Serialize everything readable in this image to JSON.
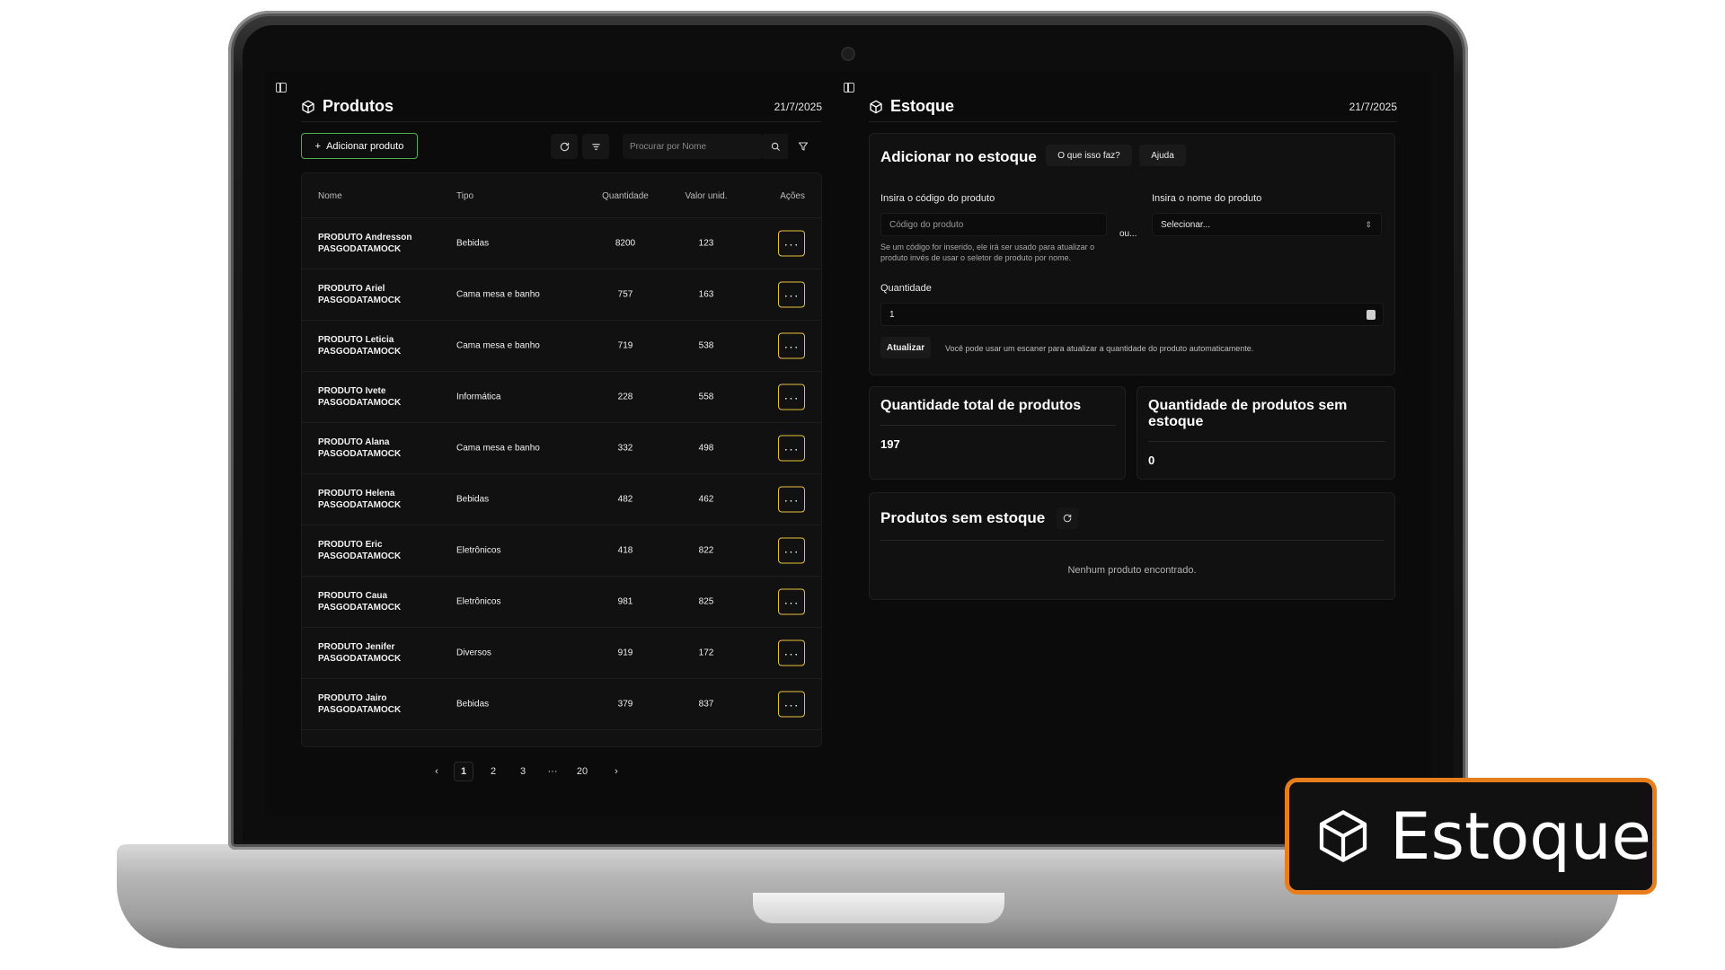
{
  "left_panel": {
    "title": "Produtos",
    "date": "21/7/2025",
    "add_button": "Adicionar produto",
    "search_placeholder": "Procurar por Nome",
    "columns": [
      "Nome",
      "Tipo",
      "Quantidade",
      "Valor unid.",
      "Ações"
    ],
    "rows": [
      {
        "name_line1": "PRODUTO Andresson",
        "name_line2": "PASGODATAMOCK",
        "tipo": "Bebidas",
        "quantidade": "8200",
        "valor": "123"
      },
      {
        "name_line1": "PRODUTO Ariel",
        "name_line2": "PASGODATAMOCK",
        "tipo": "Cama mesa e banho",
        "quantidade": "757",
        "valor": "163"
      },
      {
        "name_line1": "PRODUTO Leticia",
        "name_line2": "PASGODATAMOCK",
        "tipo": "Cama mesa e banho",
        "quantidade": "719",
        "valor": "538"
      },
      {
        "name_line1": "PRODUTO Ivete",
        "name_line2": "PASGODATAMOCK",
        "tipo": "Informática",
        "quantidade": "228",
        "valor": "558"
      },
      {
        "name_line1": "PRODUTO Alana",
        "name_line2": "PASGODATAMOCK",
        "tipo": "Cama mesa e banho",
        "quantidade": "332",
        "valor": "498"
      },
      {
        "name_line1": "PRODUTO Helena",
        "name_line2": "PASGODATAMOCK",
        "tipo": "Bebidas",
        "quantidade": "482",
        "valor": "462"
      },
      {
        "name_line1": "PRODUTO Eric",
        "name_line2": "PASGODATAMOCK",
        "tipo": "Eletrônicos",
        "quantidade": "418",
        "valor": "822"
      },
      {
        "name_line1": "PRODUTO Caua",
        "name_line2": "PASGODATAMOCK",
        "tipo": "Eletrônicos",
        "quantidade": "981",
        "valor": "825"
      },
      {
        "name_line1": "PRODUTO Jenifer",
        "name_line2": "PASGODATAMOCK",
        "tipo": "Diversos",
        "quantidade": "919",
        "valor": "172"
      },
      {
        "name_line1": "PRODUTO Jairo",
        "name_line2": "PASGODATAMOCK",
        "tipo": "Bebidas",
        "quantidade": "379",
        "valor": "837"
      }
    ],
    "action_label": "···",
    "pagination": {
      "prev": "‹",
      "pages": [
        "1",
        "2",
        "3"
      ],
      "ellipsis": "···",
      "last": "20",
      "next": "›",
      "current": "1"
    }
  },
  "right_panel": {
    "title": "Estoque",
    "date": "21/7/2025",
    "add_stock": {
      "title": "Adicionar no estoque",
      "what_button": "O que isso faz?",
      "help_button": "Ajuda",
      "code_label": "Insira o código do produto",
      "code_placeholder": "Código do produto",
      "code_hint": "Se um código for inserido, ele irá ser usado para atualizar o produto invés de usar o seletor de produto por nome.",
      "or_text": "ou...",
      "name_label": "Insira o nome do produto",
      "name_select": "Selecionar...",
      "quantity_label": "Quantidade",
      "quantity_value": "1",
      "update_button": "Atualizar",
      "update_hint": "Você pode usar um escaner para atualizar a quantidade do produto automaticamente."
    },
    "total_card": {
      "title": "Quantidade total de produtos",
      "value": "197"
    },
    "out_of_stock_card": {
      "title": "Quantidade de produtos sem estoque",
      "value": "0"
    },
    "out_of_stock_list": {
      "title": "Produtos sem estoque",
      "empty_text": "Nenhum produto encontrado."
    }
  },
  "badge": {
    "text": "Estoque",
    "accent": "#e87d1c"
  },
  "colors": {
    "add_button_border": "#4caf50",
    "action_button_border": "#e6c13a"
  }
}
